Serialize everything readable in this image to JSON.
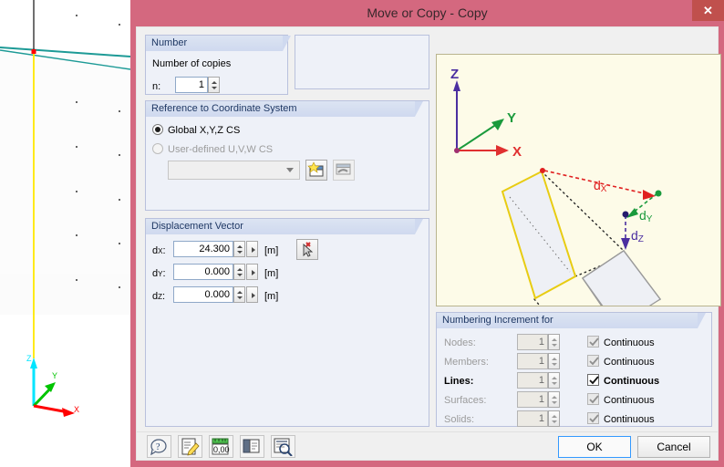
{
  "window": {
    "title": "Move or Copy - Copy",
    "close_label": "✕"
  },
  "number_group": {
    "title": "Number",
    "copies_label": "Number of copies",
    "n_label": "n:",
    "n_value": "1"
  },
  "reference_group": {
    "title": "Reference to Coordinate System",
    "option_global": "Global X,Y,Z CS",
    "option_user": "User-defined U,V,W CS",
    "selected": "global",
    "combo_value": "",
    "new_cs_icon": "new-coordinate-system-icon",
    "edit_cs_icon": "edit-coordinate-system-icon"
  },
  "displacement_group": {
    "title": "Displacement Vector",
    "unit": "[m]",
    "pick_icon": "pick-point-icon",
    "rows": [
      {
        "label_main": "d",
        "label_sub": "X",
        "value": "24.300",
        "unit": "[m]"
      },
      {
        "label_main": "d",
        "label_sub": "Y",
        "value": "0.000",
        "unit": "[m]"
      },
      {
        "label_main": "d",
        "label_sub": "Z",
        "value": "0.000",
        "unit": "[m]"
      }
    ]
  },
  "numbering_group": {
    "title": "Numbering Increment for",
    "continuous_label": "Continuous",
    "rows": [
      {
        "label": "Nodes:",
        "value": "1",
        "continuous": true,
        "enabled": false
      },
      {
        "label": "Members:",
        "value": "1",
        "continuous": true,
        "enabled": false
      },
      {
        "label": "Lines:",
        "value": "1",
        "continuous": true,
        "enabled": true
      },
      {
        "label": "Surfaces:",
        "value": "1",
        "continuous": true,
        "enabled": false
      },
      {
        "label": "Solids:",
        "value": "1",
        "continuous": true,
        "enabled": false
      }
    ]
  },
  "preview": {
    "axis_z": "Z",
    "axis_y": "Y",
    "axis_x": "X",
    "label_dx_main": "d",
    "label_dx_sub": "X",
    "label_dy_main": "d",
    "label_dy_sub": "Y",
    "label_dz_main": "d",
    "label_dz_sub": "Z",
    "colors": {
      "axis_x": "#e03030",
      "axis_y": "#1a9a3c",
      "axis_z": "#4b2fa0",
      "source_outline": "#e8cc12",
      "target_outline": "#9a9a9a",
      "face_fill": "#eef0f5",
      "background": "#fdfbe8"
    }
  },
  "toolbar": {
    "buttons": [
      {
        "icon": "help-info-icon"
      },
      {
        "icon": "edit-note-icon"
      },
      {
        "icon": "units-ruler-icon"
      },
      {
        "icon": "copy-details-icon"
      },
      {
        "icon": "view-detail-search-icon"
      }
    ]
  },
  "footer": {
    "ok_label": "OK",
    "cancel_label": "Cancel"
  },
  "viewport": {
    "axis_z": "Z",
    "axis_y": "Y",
    "axis_x": "X",
    "colors": {
      "member_line": "#1d9a96",
      "highlight_line": "#ffe800",
      "node": "#ff0000",
      "axis_z": "#00e5ff",
      "axis_y": "#00c400",
      "axis_x": "#ff0000"
    }
  }
}
